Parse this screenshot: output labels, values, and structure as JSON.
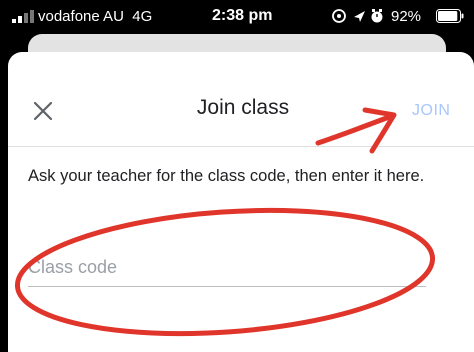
{
  "status_bar": {
    "carrier": "vodafone AU",
    "network": "4G",
    "time": "2:38 pm",
    "battery_percent": "92%",
    "battery_level": 0.92
  },
  "dialog": {
    "title": "Join class",
    "join_label": "JOIN",
    "close_icon": "close-icon",
    "description": "Ask your teacher for the class code, then enter it here.",
    "input": {
      "placeholder": "Class code",
      "value": ""
    }
  },
  "annotations": {
    "color": "#e0352b",
    "shapes": [
      "arrow",
      "ellipse"
    ]
  },
  "colors": {
    "join_disabled": "#a8c7fa",
    "text": "#202124"
  }
}
